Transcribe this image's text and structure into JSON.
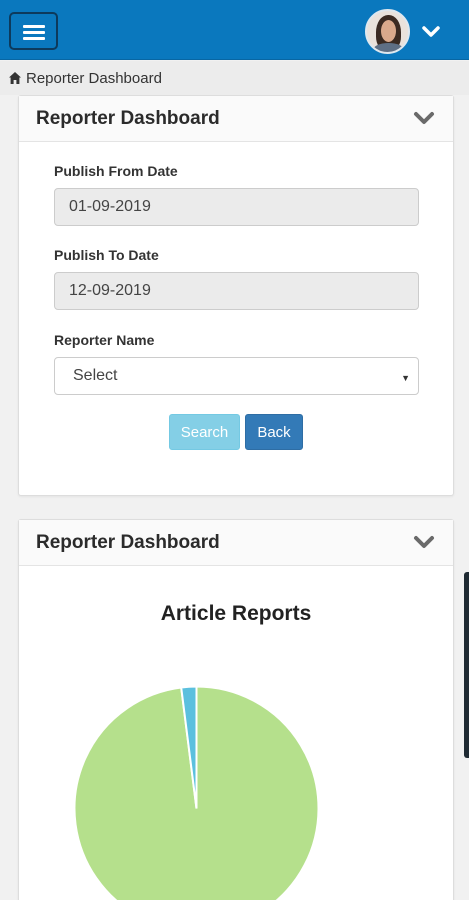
{
  "topbar": {
    "menu_icon": "hamburger-icon",
    "avatar_alt": "user avatar",
    "avatar_caret_icon": "chevron-down-icon",
    "bg_color": "#0a78be"
  },
  "breadcrumb": {
    "icon": "home-icon",
    "label": "Reporter Dashboard"
  },
  "filter_panel": {
    "title": "Reporter Dashboard",
    "collapse_icon": "chevron-down-icon",
    "from_label": "Publish From Date",
    "from_value": "01-09-2019",
    "to_label": "Publish To Date",
    "to_value": "12-09-2019",
    "reporter_label": "Reporter Name",
    "reporter_value": "Select",
    "search_label": "Search",
    "back_label": "Back"
  },
  "chart_panel": {
    "title": "Reporter Dashboard",
    "collapse_icon": "chevron-down-icon"
  },
  "chart_data": {
    "type": "pie",
    "title": "Article Reports",
    "slices": [
      {
        "value": 98,
        "color": "#b5e08c"
      },
      {
        "value": 2,
        "color": "#5bc0de"
      }
    ]
  }
}
